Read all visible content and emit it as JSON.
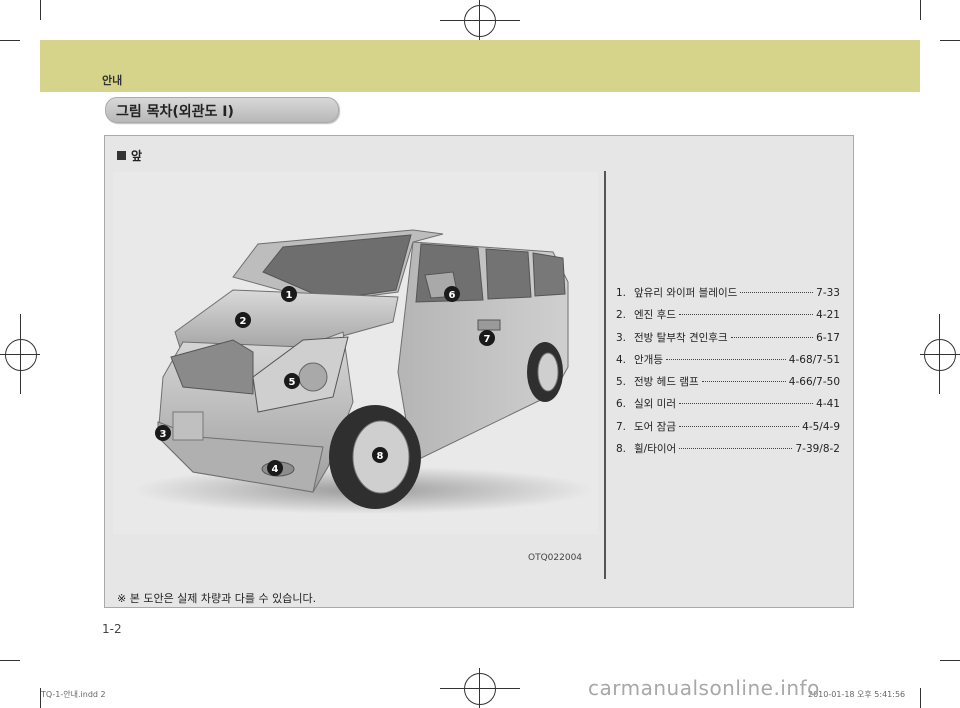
{
  "header": {
    "title": "안내"
  },
  "section": {
    "title": "그림 목차(외관도 I)"
  },
  "view": {
    "label": "앞"
  },
  "photo": {
    "code": "OTQ022004",
    "callouts": [
      "1",
      "2",
      "3",
      "4",
      "5",
      "6",
      "7",
      "8"
    ]
  },
  "items": [
    {
      "num": "1.",
      "label": "앞유리 와이퍼 블레이드",
      "page": "7-33"
    },
    {
      "num": "2.",
      "label": "엔진 후드",
      "page": "4-21"
    },
    {
      "num": "3.",
      "label": "전방 탈부착 견인후크",
      "page": "6-17"
    },
    {
      "num": "4.",
      "label": "안개등",
      "page": "4-68/7-51"
    },
    {
      "num": "5.",
      "label": "전방 헤드 램프",
      "page": "4-66/7-50"
    },
    {
      "num": "6.",
      "label": "실외 미러",
      "page": "4-41"
    },
    {
      "num": "7.",
      "label": "도어 잠금",
      "page": "4-5/4-9"
    },
    {
      "num": "8.",
      "label": "휠/타이어",
      "page": "7-39/8-2"
    }
  ],
  "footnote": "※ 본 도안은 실제 차량과 다를 수 있습니다.",
  "page_number": "1-2",
  "slug": {
    "left": "TQ-1-안내.indd   2",
    "right": "2010-01-18   오후 5:41:56"
  },
  "watermark": "carmanualsonline.info"
}
